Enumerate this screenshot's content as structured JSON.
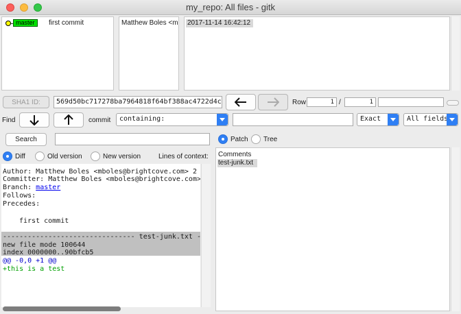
{
  "window": {
    "title": "my_repo: All files - gitk"
  },
  "commits": {
    "branch": "master",
    "message": "first commit",
    "author": "Matthew Boles <m",
    "date": "2017-11-14 16:42:12"
  },
  "sha1": {
    "label": "SHA1 ID:",
    "value": "569d50bc717278ba7964818f64bf388ac4722d4c"
  },
  "nav": {
    "back_icon": "arrow-left-icon",
    "forward_icon": "arrow-right-icon",
    "row_label": "Row",
    "row_current": "1",
    "row_sep": "/",
    "row_total": "1"
  },
  "find": {
    "label": "Find",
    "down_icon": "arrow-down-icon",
    "up_icon": "arrow-up-icon",
    "commit_label": "commit",
    "type": "containing:",
    "text": "",
    "match": "Exact",
    "fields": "All fields"
  },
  "search": {
    "button": "Search",
    "text": ""
  },
  "diffopts": {
    "diff": "Diff",
    "old": "Old version",
    "new": "New version",
    "context_label": "Lines of context:"
  },
  "tree": {
    "patch": "Patch",
    "tree": "Tree",
    "items": [
      "Comments",
      "test-junk.txt"
    ]
  },
  "details": {
    "author": "Author: Matthew Boles <mboles@brightcove.com>  2",
    "committer": "Committer: Matthew Boles <mboles@brightcove.com>",
    "branch_label": "Branch: ",
    "branch_value": "master",
    "follows": "Follows:",
    "precedes": "Precedes:",
    "message": "first commit",
    "file_header": "-------------------------------- test-junk.txt -",
    "mode": "new file mode 100644",
    "index": "index 0000000..90bfcb5",
    "hunk": "@@ -0,0 +1 @@",
    "added": "+this is a test"
  },
  "colors": {
    "branch_tag": "#00e000",
    "accent": "#2f7ff4",
    "hunk": "#0000cc",
    "added": "#00a000"
  }
}
